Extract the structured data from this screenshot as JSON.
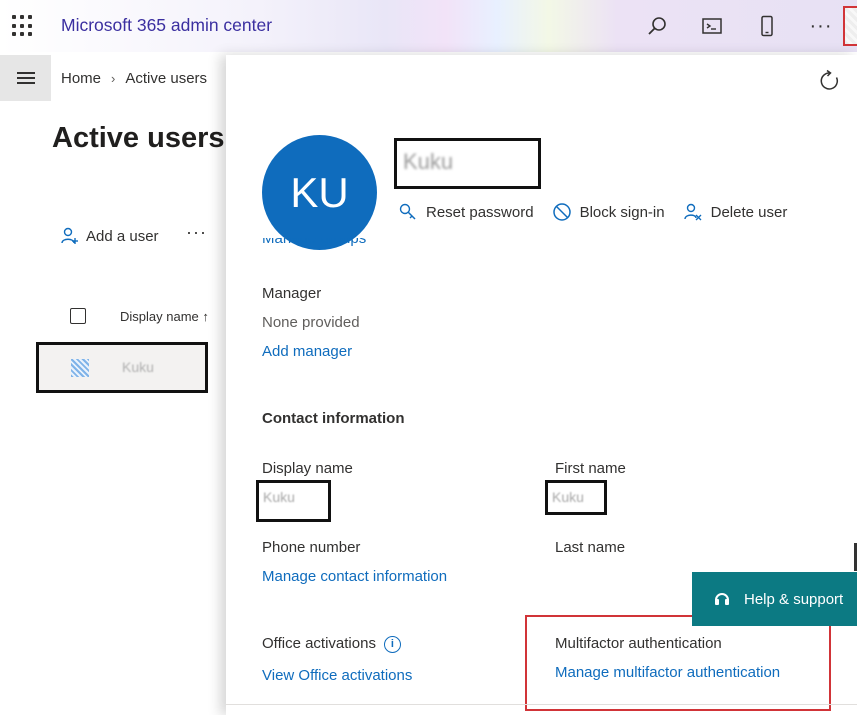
{
  "topbar": {
    "app_title": "Microsoft 365 admin center",
    "icons": [
      "app-launcher-icon",
      "search-icon",
      "terminal-icon",
      "mobile-icon",
      "more-icon"
    ],
    "more_label": "···"
  },
  "breadcrumb": {
    "home": "Home",
    "separator": "›",
    "current": "Active users"
  },
  "page": {
    "title": "Active users",
    "add_user": "Add a user",
    "more": "···",
    "column_display_name": "Display name ↑",
    "row_name": "Kuku"
  },
  "panel": {
    "avatar_initials": "KU",
    "user_name": "Kuku",
    "actions": {
      "reset_password": "Reset password",
      "block_sign_in": "Block sign-in",
      "delete_user": "Delete user"
    },
    "manage_groups": "Manage groups",
    "manager": {
      "label": "Manager",
      "value": "None provided",
      "link": "Add manager"
    },
    "contact": {
      "heading": "Contact information",
      "display_name_label": "Display name",
      "display_name_value": "Kuku",
      "first_name_label": "First name",
      "first_name_value": "Kuku",
      "phone_label": "Phone number",
      "phone_link": "Manage contact information",
      "last_name_label": "Last name"
    },
    "office": {
      "label": "Office activations",
      "link": "View Office activations"
    },
    "mfa": {
      "label": "Multifactor authentication",
      "link": "Manage multifactor authentication"
    }
  },
  "help": {
    "label": "Help & support"
  },
  "colors": {
    "accent": "#0f6cbd",
    "title": "#3b2fa0",
    "help_bg": "#0c7a83",
    "highlight": "#d13438"
  }
}
